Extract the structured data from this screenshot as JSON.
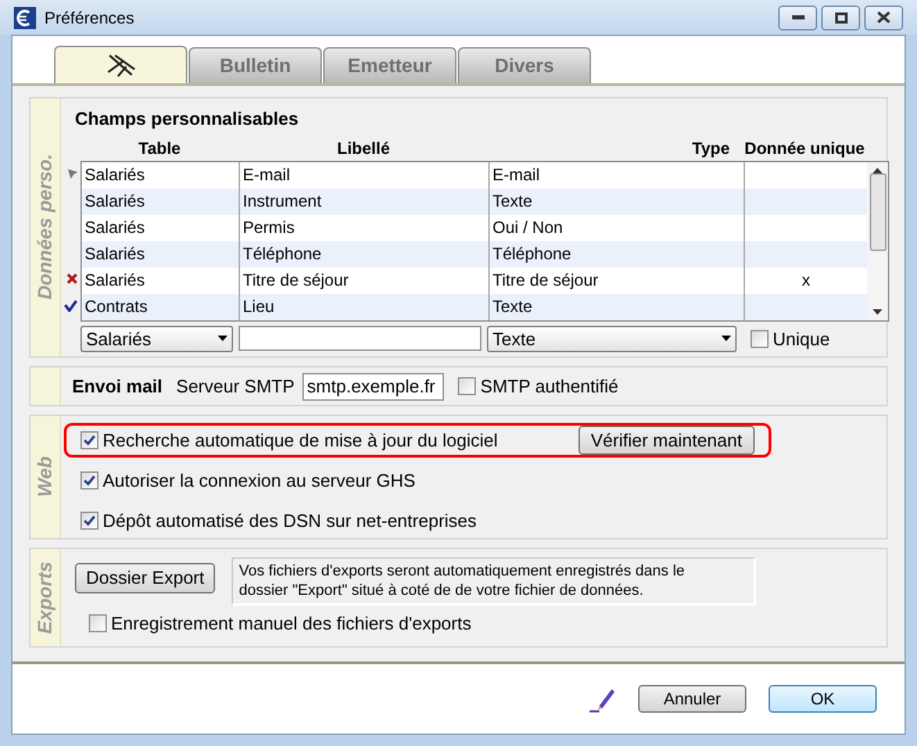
{
  "window": {
    "title": "Préférences"
  },
  "tabs": [
    {
      "kind": "icon",
      "selected": true
    },
    {
      "kind": "text",
      "label": "Bulletin",
      "selected": false
    },
    {
      "kind": "text",
      "label": "Emetteur",
      "selected": false
    },
    {
      "kind": "text",
      "label": "Divers",
      "selected": false
    }
  ],
  "custom_fields": {
    "section": "Données perso.",
    "title": "Champs personnalisables",
    "columns": [
      "Table",
      "Libellé",
      "Type",
      "Donnée unique"
    ],
    "rows": [
      {
        "kind": "current",
        "cells": [
          "Salariés",
          "E-mail",
          "E-mail"
        ]
      },
      {
        "kind": "plain",
        "cells": [
          "Salariés",
          "Instrument",
          "Texte"
        ]
      },
      {
        "kind": "plain",
        "cells": [
          "Salariés",
          "Permis",
          "Oui / Non"
        ]
      },
      {
        "kind": "plain",
        "cells": [
          "Salariés",
          "Téléphone",
          "Téléphone"
        ]
      },
      {
        "kind": "delete",
        "cells": [
          "Salariés",
          "Titre de séjour",
          "Titre de séjour"
        ],
        "unique": "x"
      },
      {
        "kind": "valid",
        "cells": [
          "Contrats",
          "Lieu",
          "Texte"
        ]
      }
    ],
    "new_row": {
      "table": "Salariés",
      "type": "Texte",
      "unique_label": "Unique",
      "unique_checked": false
    }
  },
  "mail": {
    "title": "Envoi mail",
    "server_label": "Serveur SMTP",
    "server_value": "smtp.exemple.fr",
    "auth_label": "SMTP authentifié",
    "auth_checked": false
  },
  "web": {
    "section": "Web",
    "options": [
      {
        "label": "Recherche automatique de mise à jour du logiciel",
        "checked": true,
        "highlighted": true,
        "button": "Vérifier maintenant"
      },
      {
        "label": "Autoriser la connexion au serveur GHS",
        "checked": true,
        "highlighted": false
      },
      {
        "label": "Dépôt automatisé des DSN sur net-entreprises",
        "checked": true,
        "highlighted": false
      }
    ]
  },
  "exports": {
    "section": "Exports",
    "button": "Dossier Export",
    "info": "Vos fichiers d'exports seront automatiquement enregistrés dans le dossier \"Export\" situé à coté de de votre fichier de données.",
    "manual_label": "Enregistrement manuel des fichiers d'exports",
    "manual_checked": false
  },
  "footer": {
    "cancel": "Annuler",
    "ok": "OK"
  }
}
